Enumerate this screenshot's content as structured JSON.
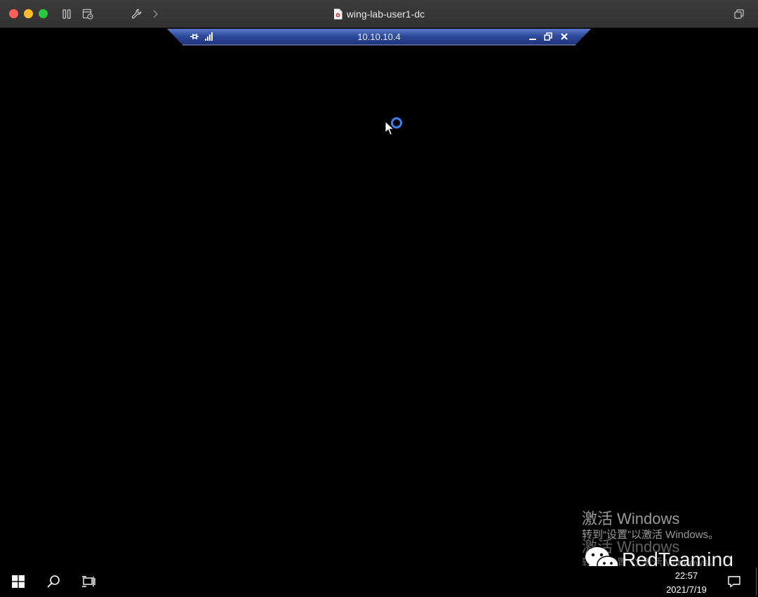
{
  "window": {
    "title": "wing-lab-user1-dc"
  },
  "rdp_bar": {
    "host": "10.10.10.4",
    "bg_color": "#2f4a9c"
  },
  "watermark": {
    "activate_title": "激活 Windows",
    "activate_hint": "转到“设置”以激活 Windows。",
    "ghost_title": "激活 Windows",
    "ghost_hint": "转到“设置”以激活 Windows。",
    "brand": "RedTeaming"
  },
  "taskbar": {
    "time": "22:57",
    "date": "2021/7/19"
  },
  "icons": {
    "start": "windows-logo-icon",
    "search": "search-icon",
    "task_view": "task-view-icon",
    "notifications": "action-center-icon"
  }
}
